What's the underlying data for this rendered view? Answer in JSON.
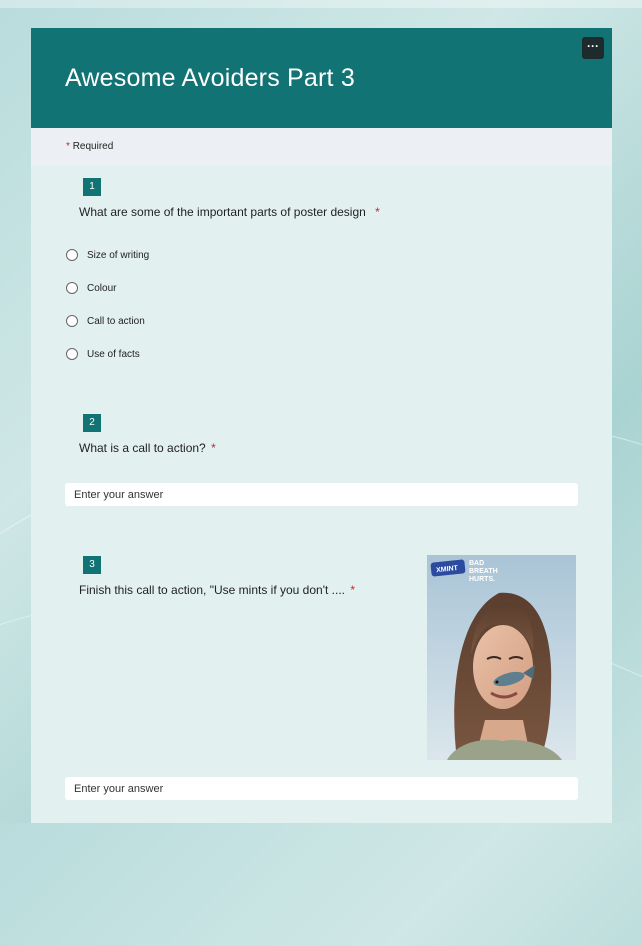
{
  "form": {
    "title": "Awesome Avoiders Part 3",
    "more_label": "···",
    "required_star": "*",
    "required_label": "Required"
  },
  "questions": [
    {
      "number": "1",
      "text": "What are some of the important parts of poster design",
      "required_star": "*",
      "options": [
        "Size of writing",
        "Colour",
        "Call to action",
        "Use of facts"
      ]
    },
    {
      "number": "2",
      "text": "What is a call to action?",
      "required_star": "*",
      "placeholder": "Enter your answer"
    },
    {
      "number": "3",
      "text": "Finish this call to action, \"Use mints if you don't ....",
      "required_star": "*",
      "placeholder": "Enter your answer",
      "image": {
        "brand": "XMINT",
        "slogan_line1": "BAD",
        "slogan_line2": "BREATH",
        "slogan_line3": "HURTS."
      }
    }
  ],
  "colors": {
    "header": "#127374",
    "accent_required": "#c4262e",
    "card": "#e3f0f0"
  }
}
